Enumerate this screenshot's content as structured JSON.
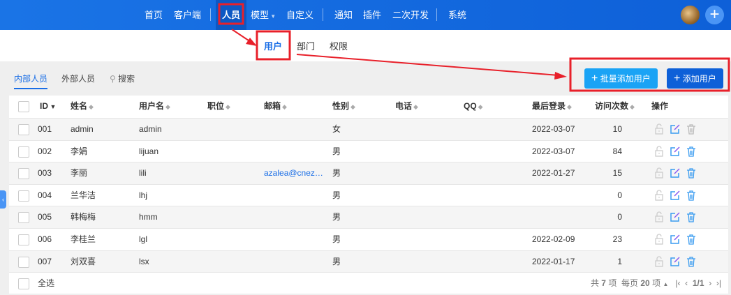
{
  "topnav": {
    "items": [
      "首页",
      "客户端",
      "人员",
      "模型",
      "自定义",
      "通知",
      "插件",
      "二次开发",
      "系统"
    ],
    "active": "人员"
  },
  "subnav": {
    "items": [
      "用户",
      "部门",
      "权限"
    ],
    "active": "用户"
  },
  "tabs": {
    "internal": "内部人员",
    "external": "外部人员",
    "search": "搜索"
  },
  "buttons": {
    "batch_add": "批量添加用户",
    "add": "添加用户"
  },
  "colors": {
    "primary": "#0e60d8",
    "batch": "#1aa3f5",
    "annotation": "#e8202a"
  },
  "table": {
    "headers": [
      "ID",
      "姓名",
      "用户名",
      "职位",
      "邮箱",
      "性别",
      "电话",
      "QQ",
      "最后登录",
      "访问次数",
      "操作"
    ],
    "rows": [
      {
        "id": "001",
        "name": "admin",
        "username": "admin",
        "title": "",
        "email": "",
        "gender": "女",
        "phone": "",
        "qq": "",
        "last_login": "2022-03-07",
        "visits": "10",
        "deletable": false
      },
      {
        "id": "002",
        "name": "李娟",
        "username": "lijuan",
        "title": "",
        "email": "",
        "gender": "男",
        "phone": "",
        "qq": "",
        "last_login": "2022-03-07",
        "visits": "84",
        "deletable": true
      },
      {
        "id": "003",
        "name": "李丽",
        "username": "lili",
        "title": "",
        "email": "azalea@cnez…",
        "gender": "男",
        "phone": "",
        "qq": "",
        "last_login": "2022-01-27",
        "visits": "15",
        "deletable": true
      },
      {
        "id": "004",
        "name": "兰华洁",
        "username": "lhj",
        "title": "",
        "email": "",
        "gender": "男",
        "phone": "",
        "qq": "",
        "last_login": "",
        "visits": "0",
        "deletable": true
      },
      {
        "id": "005",
        "name": "韩梅梅",
        "username": "hmm",
        "title": "",
        "email": "",
        "gender": "男",
        "phone": "",
        "qq": "",
        "last_login": "",
        "visits": "0",
        "deletable": true
      },
      {
        "id": "006",
        "name": "李桂兰",
        "username": "lgl",
        "title": "",
        "email": "",
        "gender": "男",
        "phone": "",
        "qq": "",
        "last_login": "2022-02-09",
        "visits": "23",
        "deletable": true
      },
      {
        "id": "007",
        "name": "刘双喜",
        "username": "lsx",
        "title": "",
        "email": "",
        "gender": "男",
        "phone": "",
        "qq": "",
        "last_login": "2022-01-17",
        "visits": "1",
        "deletable": true
      }
    ],
    "select_all": "全选"
  },
  "pagination": {
    "total_label": "共",
    "total": "7",
    "unit": "项",
    "per_page_label": "每页",
    "per_page": "20",
    "page": "1/1"
  }
}
